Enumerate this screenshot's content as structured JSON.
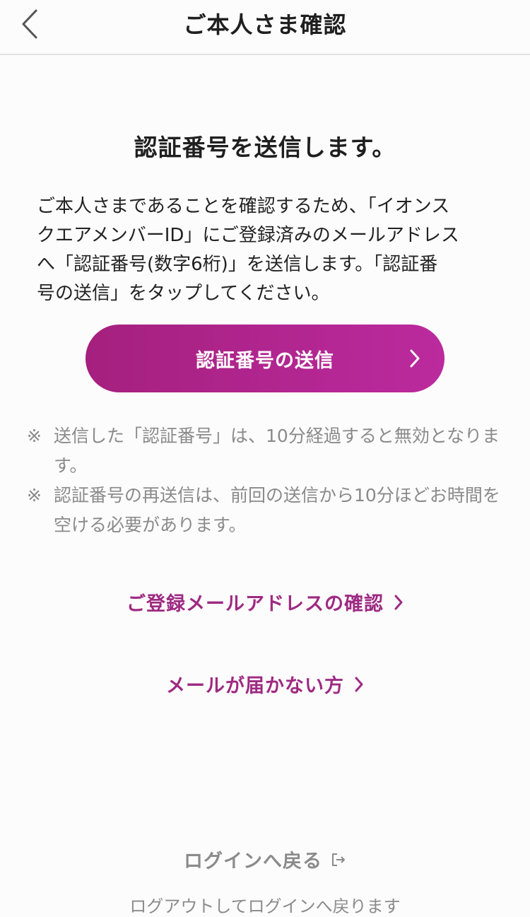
{
  "header": {
    "title": "ご本人さま確認"
  },
  "main": {
    "heading": "認証番号を送信します。",
    "description": "ご本人さまであることを確認するため、「イオンス\nクエアメンバーID」にご登録済みのメールアドレス\nへ「認証番号(数字6桁)」を送信します。「認証番\n号の送信」をタップしてください。",
    "send_button_label": "認証番号の送信",
    "notes": [
      {
        "mark": "※",
        "text": "送信した「認証番号」は、10分経過すると無効となります。"
      },
      {
        "mark": "※",
        "text": "認証番号の再送信は、前回の送信から10分ほどお時間を空ける必要があります。"
      }
    ],
    "links": {
      "confirm_email": "ご登録メールアドレスの確認",
      "no_email": "メールが届かない方"
    }
  },
  "footer": {
    "login_link": "ログインへ戻る",
    "sub_text": "ログアウトしてログインへ戻ります"
  },
  "colors": {
    "accent": "#9e2a82",
    "button_gradient_start": "#a5207e",
    "button_gradient_end": "#bb2a9e",
    "note_text": "#8a8a8a"
  }
}
